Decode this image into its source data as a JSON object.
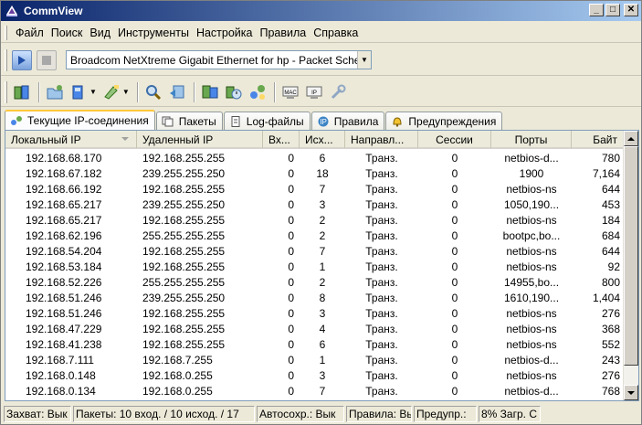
{
  "window": {
    "title": "CommView"
  },
  "titlebar_buttons": {
    "minimize": "_",
    "maximize": "□",
    "close": "✕"
  },
  "menu": [
    "Файл",
    "Поиск",
    "Вид",
    "Инструменты",
    "Настройка",
    "Правила",
    "Справка"
  ],
  "adapter": {
    "selected": "Broadcom NetXtreme Gigabit Ethernet for hp - Packet Scheduler Miniport"
  },
  "toolbar_icons": [
    "open-session-icon",
    "open-folder-icon",
    "save-icon",
    "highlight-icon",
    "search-icon",
    "log-icon",
    "statistics-icon",
    "scheduler-icon",
    "nodes-icon",
    "mac-alias-icon",
    "ip-alias-icon",
    "settings-wrench-icon"
  ],
  "tabs": [
    {
      "label": "Текущие IP-соединения",
      "active": true
    },
    {
      "label": "Пакеты",
      "active": false
    },
    {
      "label": "Log-файлы",
      "active": false
    },
    {
      "label": "Правила",
      "active": false
    },
    {
      "label": "Предупреждения",
      "active": false
    }
  ],
  "table": {
    "columns": [
      "Локальный IP",
      "Удаленный IP",
      "Вх...",
      "Исх...",
      "Направл...",
      "Сессии",
      "Порты",
      "Байт"
    ],
    "rows": [
      [
        "192.168.68.170",
        "192.168.255.255",
        "0",
        "6",
        "Транз.",
        "0",
        "netbios-d...",
        "780"
      ],
      [
        "192.168.67.182",
        "239.255.255.250",
        "0",
        "18",
        "Транз.",
        "0",
        "1900",
        "7,164"
      ],
      [
        "192.168.66.192",
        "192.168.255.255",
        "0",
        "7",
        "Транз.",
        "0",
        "netbios-ns",
        "644"
      ],
      [
        "192.168.65.217",
        "239.255.255.250",
        "0",
        "3",
        "Транз.",
        "0",
        "1050,190...",
        "453"
      ],
      [
        "192.168.65.217",
        "192.168.255.255",
        "0",
        "2",
        "Транз.",
        "0",
        "netbios-ns",
        "184"
      ],
      [
        "192.168.62.196",
        "255.255.255.255",
        "0",
        "2",
        "Транз.",
        "0",
        "bootpc,bo...",
        "684"
      ],
      [
        "192.168.54.204",
        "192.168.255.255",
        "0",
        "7",
        "Транз.",
        "0",
        "netbios-ns",
        "644"
      ],
      [
        "192.168.53.184",
        "192.168.255.255",
        "0",
        "1",
        "Транз.",
        "0",
        "netbios-ns",
        "92"
      ],
      [
        "192.168.52.226",
        "255.255.255.255",
        "0",
        "2",
        "Транз.",
        "0",
        "14955,bo...",
        "800"
      ],
      [
        "192.168.51.246",
        "239.255.255.250",
        "0",
        "8",
        "Транз.",
        "0",
        "1610,190...",
        "1,404"
      ],
      [
        "192.168.51.246",
        "192.168.255.255",
        "0",
        "3",
        "Транз.",
        "0",
        "netbios-ns",
        "276"
      ],
      [
        "192.168.47.229",
        "192.168.255.255",
        "0",
        "4",
        "Транз.",
        "0",
        "netbios-ns",
        "368"
      ],
      [
        "192.168.41.238",
        "192.168.255.255",
        "0",
        "6",
        "Транз.",
        "0",
        "netbios-ns",
        "552"
      ],
      [
        "192.168.7.111",
        "192.168.7.255",
        "0",
        "1",
        "Транз.",
        "0",
        "netbios-d...",
        "243"
      ],
      [
        "192.168.0.148",
        "192.168.0.255",
        "0",
        "3",
        "Транз.",
        "0",
        "netbios-ns",
        "276"
      ],
      [
        "192.168.0.134",
        "192.168.0.255",
        "0",
        "7",
        "Транз.",
        "0",
        "netbios-d...",
        "768"
      ]
    ]
  },
  "statusbar": [
    "Захват: Вык",
    "Пакеты: 10 вход. / 10 исход. / 17",
    "Автосохр.: Вык",
    "Правила: Вы",
    "Предупр.:",
    "8% Загр. С"
  ],
  "colors": {
    "titlebar_start": "#0a246a",
    "titlebar_end": "#a6caf0",
    "active_tab_accent": "#ffc83c"
  }
}
